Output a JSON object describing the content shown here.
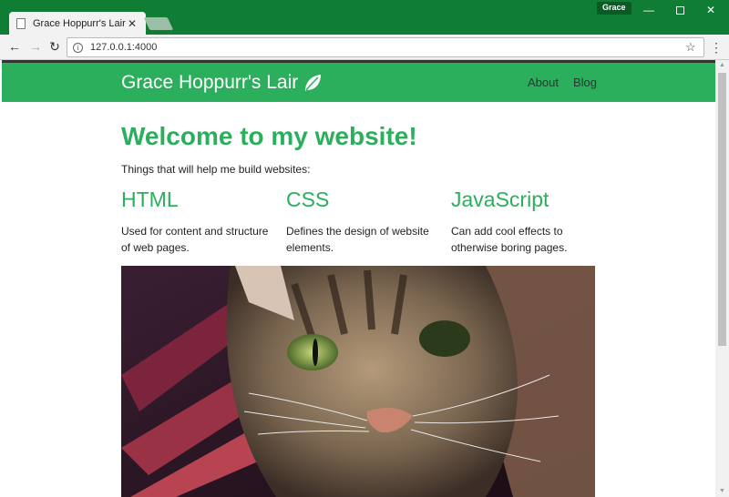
{
  "browser": {
    "tab_title": "Grace Hoppurr's Lair",
    "tab_close": "✕",
    "profile_name": "Grace",
    "url": "127.0.0.1:4000"
  },
  "site": {
    "brand": "Grace Hoppurr's Lair",
    "nav": [
      "About",
      "Blog"
    ],
    "heading": "Welcome to my website!",
    "intro": "Things that will help me build websites:",
    "columns": [
      {
        "title": "HTML",
        "text": "Used for content and structure of web pages."
      },
      {
        "title": "CSS",
        "text": "Defines the design of website elements."
      },
      {
        "title": "JavaScript",
        "text": "Can add cool effects to otherwise boring pages."
      }
    ]
  },
  "colors": {
    "chrome": "#0f7d34",
    "accent": "#2baf5d"
  },
  "icons": {
    "brand": "leaf-icon",
    "tab": "document-icon",
    "omnibox": "info-icon"
  }
}
